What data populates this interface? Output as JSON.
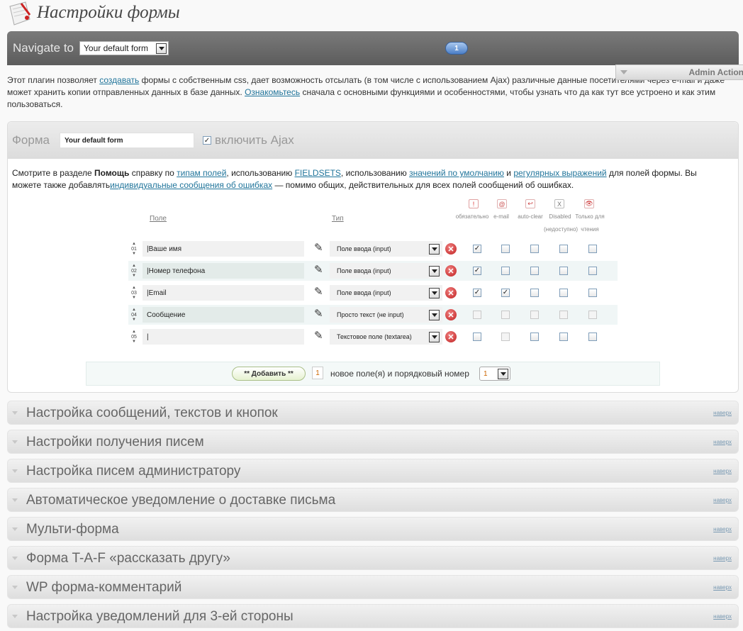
{
  "page": {
    "title": "Настройки формы"
  },
  "nav": {
    "label": "Navigate to",
    "selected_form": "Your default form",
    "page_number": "1"
  },
  "admin_action": {
    "label": "Admin Action"
  },
  "intro": {
    "p1": "Этот плагин позволяет ",
    "link1": "создавать",
    "p2": " формы с собственным css, дает возможность отсылать (в том числе с использованием Ajax) различные данные посетителями через e-mail и даже может хранить копии отправленных данных в базе данных. ",
    "link2": "Ознакомьтесь",
    "p3": " сначала с основными функциями и особенностями, чтобы узнать что да как тут все устроено и как этим пользоваться."
  },
  "form": {
    "label": "Форма",
    "name_value": "Your default form",
    "ajax_label": "включить Ajax",
    "ajax_checked": "✓",
    "help": {
      "t1": "Смотрите в разделе ",
      "bold": "Помощь",
      "t2": " справку по ",
      "l1": "типам полей",
      "t3": ", использованию ",
      "l2": "FIELDSETS",
      "t4": ", использованию ",
      "l3": "значений по умолчанию",
      "t5": " и ",
      "l4": "регулярных выражений",
      "t6": " для полей формы. Вы можете также добавлять",
      "l5": "индивидуальные сообщения об ошибках",
      "t7": " — помимо общих, действительных для всех полей сообщений об ошибках."
    },
    "columns": {
      "field": "Поле",
      "type": "Тип",
      "required": "обязательно",
      "email": "e-mail",
      "autoclear": "auto-clear",
      "disabled": "Disabled",
      "disabled_note": "(недоступно)",
      "readonly": "Только для",
      "readonly_note": "чтения"
    },
    "rows": [
      {
        "num": "01",
        "name": "|Ваше имя",
        "type": "Поле ввода (input)",
        "checks": [
          "✓",
          "",
          "",
          "",
          ""
        ],
        "disabled": [
          false,
          false,
          false,
          false,
          false
        ]
      },
      {
        "num": "02",
        "name": "|Номер телефона",
        "type": "Поле ввода (input)",
        "checks": [
          "✓",
          "",
          "",
          "",
          ""
        ],
        "disabled": [
          false,
          false,
          false,
          false,
          false
        ]
      },
      {
        "num": "03",
        "name": "|Email",
        "type": "Поле ввода (input)",
        "checks": [
          "✓",
          "✓",
          "",
          "",
          ""
        ],
        "disabled": [
          false,
          false,
          false,
          false,
          false
        ]
      },
      {
        "num": "04",
        "name": "Сообщение",
        "type": "Просто текст (не input)",
        "checks": [
          "",
          "",
          "",
          "",
          ""
        ],
        "disabled": [
          true,
          true,
          true,
          true,
          true
        ]
      },
      {
        "num": "05",
        "name": "|",
        "type": "Текстовое поле (textarea)",
        "checks": [
          "",
          "",
          "",
          "",
          ""
        ],
        "disabled": [
          false,
          true,
          false,
          false,
          false
        ]
      }
    ],
    "add": {
      "button": "** Добавить **",
      "count": "1",
      "text": "новое поле(я) и порядковый номер",
      "position": "1"
    }
  },
  "sections": [
    {
      "title": "Настройка сообщений, текстов и кнопок",
      "link": "наверх"
    },
    {
      "title": "Настройки получения писем",
      "link": "наверх"
    },
    {
      "title": "Настройка писем администратору",
      "link": "наверх"
    },
    {
      "title": "Автоматическое уведомление о доставке письма",
      "link": "наверх"
    },
    {
      "title": "Мульти-форма",
      "link": "наверх"
    },
    {
      "title": "Форма T-A-F «рассказать другу»",
      "link": "наверх"
    },
    {
      "title": "WP форма-комментарий",
      "link": "наверх"
    },
    {
      "title": "Настройка уведомлений для 3-ей стороны",
      "link": "наверх"
    }
  ],
  "icons": {
    "logo": "form-logo-icon",
    "required": "exclamation-icon",
    "email": "at-icon",
    "autoclear": "undo-icon",
    "disabled": "x-icon",
    "readonly": "eye-icon",
    "edit": "pencil-icon",
    "delete": "delete-icon",
    "sort": "sort-handle-icon"
  }
}
